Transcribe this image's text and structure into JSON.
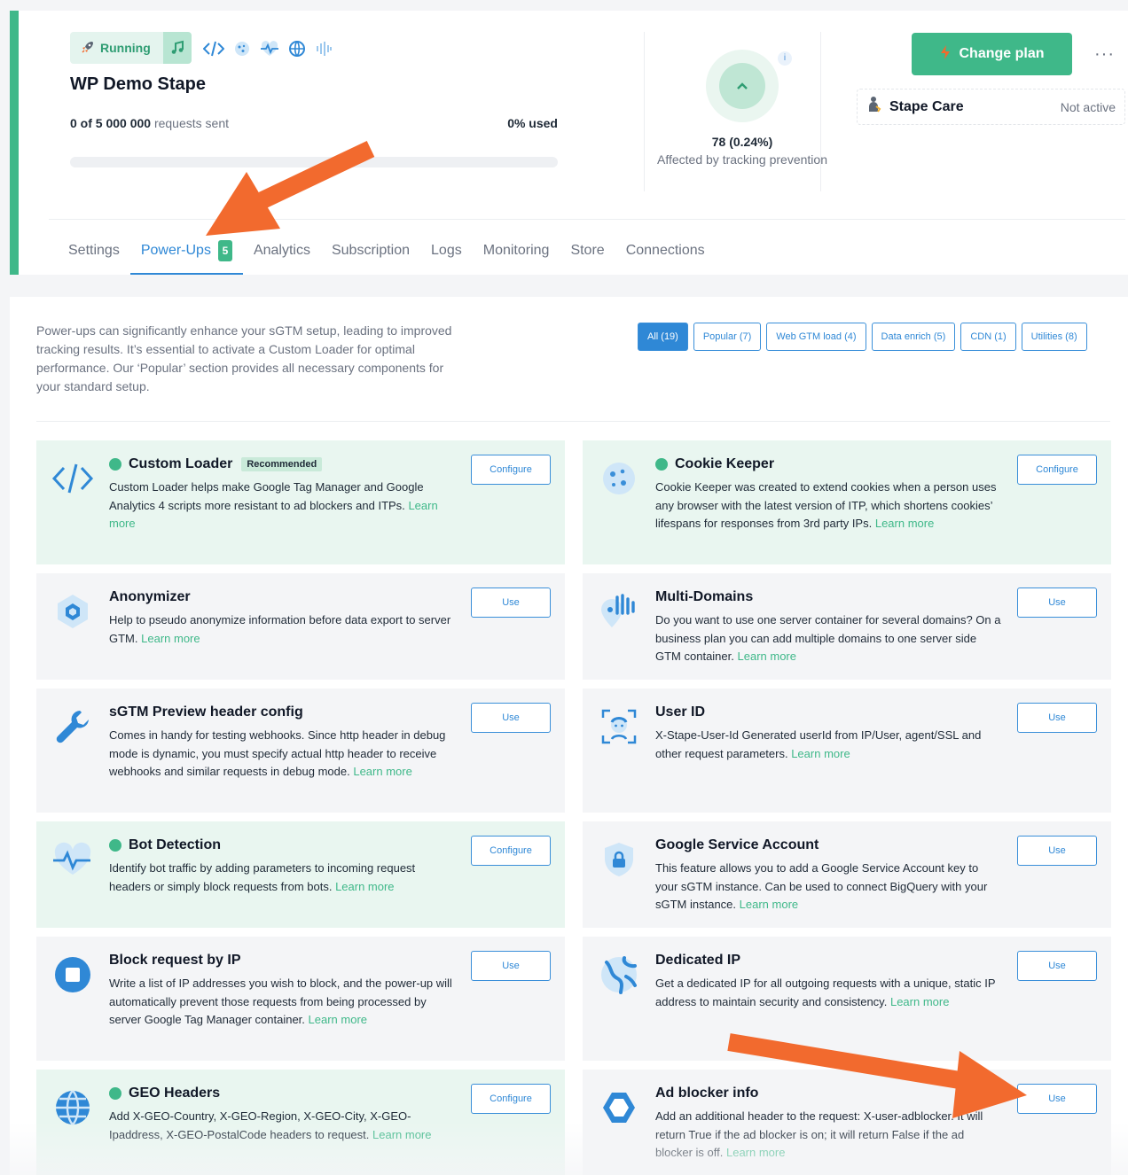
{
  "header": {
    "status": "Running",
    "site_title": "WP Demo Stape",
    "requests_count": "0 of 5 000 000",
    "requests_suffix": " requests sent",
    "used": "0% used",
    "usage_fraction": 0,
    "tracking_value": "78 (0.24%)",
    "tracking_caption": "Affected by tracking prevention",
    "info": "i",
    "change_plan": "Change plan",
    "more": "···",
    "stape_care": "Stape Care",
    "stape_care_state": "Not active"
  },
  "tabs": [
    {
      "label": "Settings"
    },
    {
      "label": "Power-Ups",
      "badge": "5"
    },
    {
      "label": "Analytics"
    },
    {
      "label": "Subscription"
    },
    {
      "label": "Logs"
    },
    {
      "label": "Monitoring"
    },
    {
      "label": "Store"
    },
    {
      "label": "Connections"
    }
  ],
  "panel": {
    "intro": "Power-ups can significantly enhance your sGTM setup, leading to improved tracking results. It’s essential to activate a Custom Loader for optimal performance. Our ‘Popular’ section provides all necessary components for your standard setup.",
    "filters": [
      "All (19)",
      "Popular (7)",
      "Web GTM load (4)",
      "Data enrich (5)",
      "CDN (1)",
      "Utilities (8)"
    ]
  },
  "cards": [
    {
      "title": "Custom Loader",
      "badge": "Recommended",
      "desc": "Custom Loader helps make Google Tag Manager and Google Analytics 4 scripts more resistant to ad blockers and ITPs.",
      "learn": "Learn more",
      "button": "Configure",
      "enabled": true,
      "icon": "code-icon"
    },
    {
      "title": "Cookie Keeper",
      "desc": "Cookie Keeper was created to extend cookies when a person uses any browser with the latest version of ITP, which shortens cookies’ lifespans for responses from 3rd party IPs.",
      "learn": "Learn more",
      "button": "Configure",
      "enabled": true,
      "icon": "cookie-icon"
    },
    {
      "title": "Anonymizer",
      "desc": "Help to pseudo anonymize information before data export to server GTM.",
      "learn": "Learn more",
      "button": "Use",
      "enabled": false,
      "icon": "hexagon-icon"
    },
    {
      "title": "Multi-Domains",
      "desc": "Do you want to use one server container for several domains? On a business plan you can add multiple domains to one server side GTM container.",
      "learn": "Learn more",
      "button": "Use",
      "enabled": false,
      "icon": "map-pin-icon"
    },
    {
      "title": "sGTM Preview header config",
      "desc": "Comes in handy for testing webhooks. Since http header in debug mode is dynamic, you must specify actual http header to receive webhooks and similar requests in debug mode.",
      "learn": "Learn more",
      "button": "Use",
      "enabled": false,
      "icon": "wrench-icon"
    },
    {
      "title": "User ID",
      "desc": "X-Stape-User-Id Generated userId from IP/User, agent/SSL and other request parameters.",
      "learn": "Learn more",
      "button": "Use",
      "enabled": false,
      "icon": "user-scan-icon"
    },
    {
      "title": "Bot Detection",
      "desc": "Identify bot traffic by adding parameters to incoming request headers or simply block requests from bots.",
      "learn": "Learn more",
      "button": "Configure",
      "enabled": true,
      "icon": "heartbeat-icon"
    },
    {
      "title": "Google Service Account",
      "desc": "This feature allows you to add a Google Service Account key to your sGTM instance. Can be used to connect BigQuery with your sGTM instance.",
      "learn": "Learn more",
      "button": "Use",
      "enabled": false,
      "icon": "shield-lock-icon"
    },
    {
      "title": "Block request by IP",
      "desc": "Write a list of IP addresses you wish to block, and the power-up will automatically prevent those requests from being processed by server Google Tag Manager container.",
      "learn": "Learn more",
      "button": "Use",
      "enabled": false,
      "icon": "stop-icon"
    },
    {
      "title": "Dedicated IP",
      "desc": "Get a dedicated IP for all outgoing requests with a unique, static IP address to maintain security and consistency.",
      "learn": "Learn more",
      "button": "Use",
      "enabled": false,
      "icon": "globe-map-icon"
    },
    {
      "title": "GEO Headers",
      "desc": "Add X-GEO-Country, X-GEO-Region, X-GEO-City, X-GEO-Ipaddress, X-GEO-PostalCode headers to request.",
      "learn": "Learn more",
      "button": "Configure",
      "enabled": true,
      "icon": "globe-icon"
    },
    {
      "title": "Ad blocker info",
      "desc": "Add an additional header to the request: X-user-adblocker. It will return True if the ad blocker is on; it will return False if the ad blocker is off.",
      "learn": "Learn more",
      "button": "Use",
      "enabled": false,
      "icon": "hexagon-outline-icon"
    }
  ],
  "colors": {
    "accent_green": "#3fb889",
    "accent_blue": "#2f88d6",
    "arrow": "#f26a2e"
  }
}
